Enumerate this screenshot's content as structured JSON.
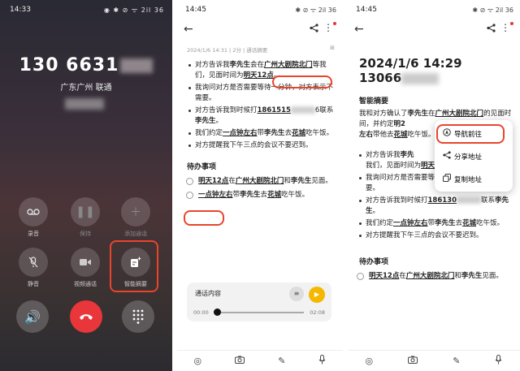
{
  "panel1": {
    "status_time": "14:33",
    "status_icons": "◉ ✱ ⊘ ᯤ 2il 36",
    "phone_number": "130 6631",
    "location": "广东广州 联通",
    "buttons": {
      "record": "录音",
      "hold": "保持",
      "add_call": "添加通话",
      "mute": "静音",
      "video": "视频通话",
      "smart_summary": "智能摘要"
    },
    "accent_color": "#e8452c"
  },
  "panel2": {
    "status_time": "14:45",
    "status_icons": "✱ ⊘ ᯤ 2il 36",
    "meta": "2024/1/6 14:31 | 2分 | 通话摘要",
    "bullets": [
      {
        "parts": [
          "对方告诉我",
          "李先生",
          "会在",
          "广州大剧院北门",
          "等我们，见面时间为",
          "明天12点",
          "。"
        ]
      },
      {
        "text": "我询问对方是否需要等待一分钟，对方表示不需要。"
      },
      {
        "parts": [
          "对方告诉我到时候打",
          "1861515",
          "6联系",
          "李先生",
          "。"
        ]
      },
      {
        "parts": [
          "我们约定",
          "一点钟左右",
          "带",
          "李先生",
          "去",
          "花城",
          "吃午饭。"
        ]
      },
      {
        "text": "对方提醒我下午三点的会议不要迟到。"
      }
    ],
    "todo_title": "待办事项",
    "todos": [
      {
        "parts": [
          "明天12点",
          "在",
          "广州大剧院北门",
          "和",
          "李先生",
          "见面。"
        ]
      },
      {
        "parts": [
          "一点钟左右",
          "带",
          "李先生",
          "去",
          "花城",
          "吃午饭。"
        ]
      }
    ],
    "player": {
      "title": "通话内容",
      "start": "00:00",
      "end": "02:08",
      "progress": 0.0
    }
  },
  "panel3": {
    "status_time": "14:45",
    "status_icons": "✱ ⊘ ᯤ 2il 36",
    "date": "2024/1/6 14:29",
    "phone": "13066",
    "summary_title": "智能摘要",
    "summary_parts": [
      "我和对方确认了",
      "李先生",
      "在",
      "广州大剧院北门",
      "的见面时间，并约定",
      "明2",
      "左右",
      "带他去",
      "花城",
      "吃午饭。"
    ],
    "bullets": [
      {
        "parts": [
          "对方告诉我",
          "李先",
          "",
          "",
          "我们，见面时间为",
          "明天12点",
          "。"
        ]
      },
      {
        "text": "我询问对方是否需要等待一分钟，对方表示不需要。"
      },
      {
        "parts": [
          "对方告诉我到时候打",
          "186130",
          "联系",
          "李先生",
          "。"
        ]
      },
      {
        "parts": [
          "我们约定",
          "一点钟左右",
          "带",
          "李先生",
          "去",
          "花城",
          "吃午饭。"
        ]
      },
      {
        "text": "对方提醒我下午三点的会议不要迟到。"
      }
    ],
    "todo_title": "待办事项",
    "todos": [
      {
        "parts": [
          "明天12点",
          "在",
          "广州大剧院北门",
          "和",
          "李先生",
          "见面。"
        ]
      }
    ],
    "menu": {
      "navigate": "导航前往",
      "share": "分享地址",
      "copy": "复制地址"
    }
  }
}
